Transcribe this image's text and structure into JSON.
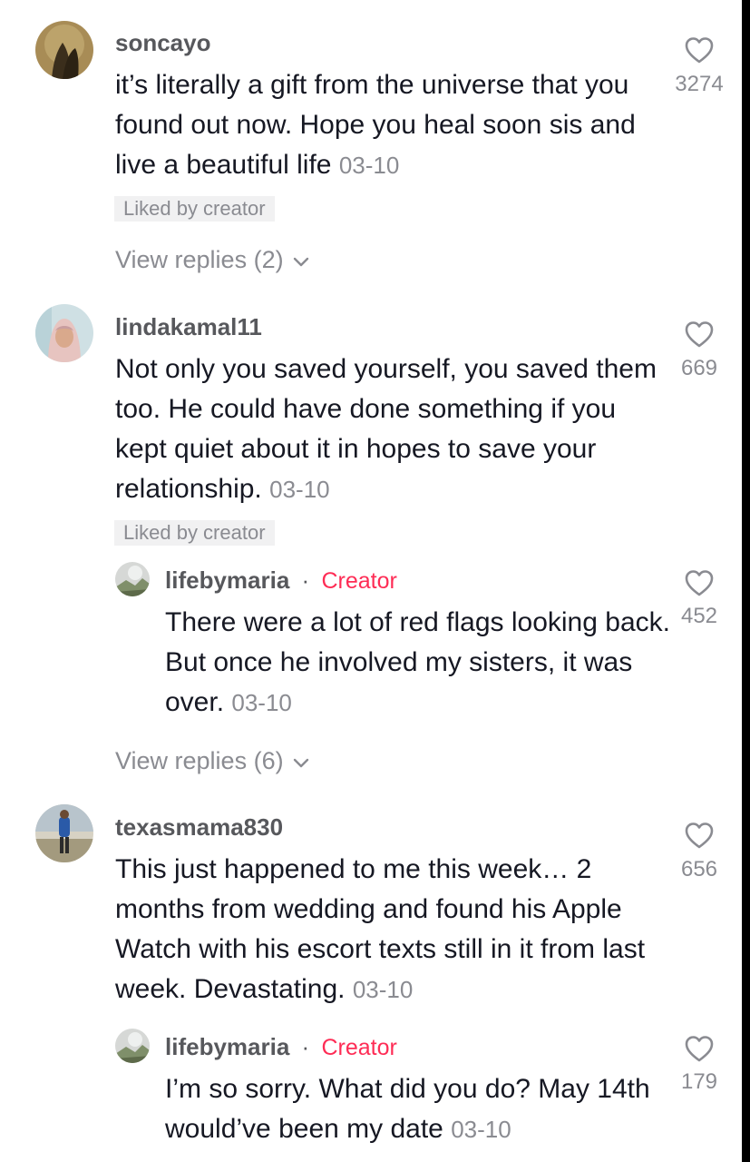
{
  "comments": [
    {
      "username": "soncayo",
      "text": "it’s literally a gift from the universe that you found out now. Hope you heal soon sis and live a beautiful life",
      "date": "03-10",
      "likes": "3274",
      "liked_by_creator": "Liked by creator",
      "view_replies": "View replies (2)"
    },
    {
      "username": "lindakamal11",
      "text": "Not only you saved yourself, you saved them too. He could have done something if you kept quiet about it in hopes to save your relationship.",
      "date": "03-10",
      "likes": "669",
      "liked_by_creator": "Liked by creator",
      "reply": {
        "username": "lifebymaria",
        "separator": "·",
        "badge": "Creator",
        "text": "There were a lot of red flags looking back. But once he involved my sisters, it was over.",
        "date": "03-10",
        "likes": "452"
      },
      "view_replies": "View replies (6)"
    },
    {
      "username": "texasmama830",
      "text": "This just happened to me this week… 2 months from wedding and found his Apple Watch with his escort texts still in it from last week. Devastating.",
      "date": "03-10",
      "likes": "656",
      "reply": {
        "username": "lifebymaria",
        "separator": "·",
        "badge": "Creator",
        "text": "I’m so sorry. What did you do? May 14th would’ve been my date",
        "date": "03-10",
        "likes": "179"
      }
    }
  ],
  "icons": {
    "like": "heart-outline-icon",
    "expand": "chevron-down-icon"
  },
  "colors": {
    "accent": "#fe2c55",
    "text": "#161823",
    "muted": "#8a8b91",
    "username": "#57585c"
  }
}
